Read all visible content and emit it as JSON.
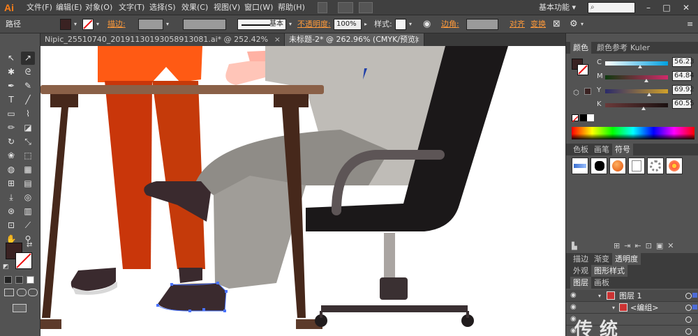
{
  "app": {
    "logo": "Ai"
  },
  "menu": [
    "文件(F)",
    "编辑(E)",
    "对象(O)",
    "文字(T)",
    "选择(S)",
    "效果(C)",
    "视图(V)",
    "窗口(W)",
    "帮助(H)"
  ],
  "workspace": {
    "label": "基本功能",
    "arrow": "▾"
  },
  "search": {
    "icon": "search-icon",
    "glyph": "⌕"
  },
  "window_controls": {
    "minimize": "–",
    "maximize": "□",
    "close": "✕"
  },
  "control_bar": {
    "object_type": "路径",
    "stroke_label": "描边:",
    "stroke_style": "基本",
    "opacity_label": "不透明度:",
    "opacity_value": "100%",
    "style_label": "样式:",
    "corner_label": "边角:",
    "align_label": "对齐",
    "transform_label": "变换",
    "fill_color": "#3a2222"
  },
  "tabs": [
    {
      "label": "Nipic_25510740_20191130193058913081.ai* @ 252.42% (CMYK/预览)",
      "close": "×"
    },
    {
      "label": "未标题-2* @ 262.96% (CMYK/预览)",
      "close": "×"
    }
  ],
  "tools": [
    {
      "icon": "selection-tool-icon",
      "glyph": "↖"
    },
    {
      "icon": "direct-selection-tool-icon",
      "glyph": "↗"
    },
    {
      "icon": "magic-wand-tool-icon",
      "glyph": "✱"
    },
    {
      "icon": "lasso-tool-icon",
      "glyph": "ᘓ"
    },
    {
      "icon": "pen-tool-icon",
      "glyph": "✒"
    },
    {
      "icon": "curvature-tool-icon",
      "glyph": "✎"
    },
    {
      "icon": "type-tool-icon",
      "glyph": "T"
    },
    {
      "icon": "line-tool-icon",
      "glyph": "╱"
    },
    {
      "icon": "rectangle-tool-icon",
      "glyph": "▭"
    },
    {
      "icon": "paintbrush-tool-icon",
      "glyph": "⌇"
    },
    {
      "icon": "pencil-tool-icon",
      "glyph": "✏"
    },
    {
      "icon": "eraser-tool-icon",
      "glyph": "◪"
    },
    {
      "icon": "rotate-tool-icon",
      "glyph": "↻"
    },
    {
      "icon": "scale-tool-icon",
      "glyph": "⤡"
    },
    {
      "icon": "warp-tool-icon",
      "glyph": "❀"
    },
    {
      "icon": "free-transform-tool-icon",
      "glyph": "⬚"
    },
    {
      "icon": "shape-builder-tool-icon",
      "glyph": "◍"
    },
    {
      "icon": "perspective-grid-tool-icon",
      "glyph": "▦"
    },
    {
      "icon": "mesh-tool-icon",
      "glyph": "⊞"
    },
    {
      "icon": "gradient-tool-icon",
      "glyph": "▤"
    },
    {
      "icon": "eyedropper-tool-icon",
      "glyph": "⤓"
    },
    {
      "icon": "blend-tool-icon",
      "glyph": "◎"
    },
    {
      "icon": "symbol-sprayer-tool-icon",
      "glyph": "⊛"
    },
    {
      "icon": "column-graph-tool-icon",
      "glyph": "▥"
    },
    {
      "icon": "artboard-tool-icon",
      "glyph": "⊡"
    },
    {
      "icon": "slice-tool-icon",
      "glyph": "⟋"
    },
    {
      "icon": "hand-tool-icon",
      "glyph": "✋"
    },
    {
      "icon": "zoom-tool-icon",
      "glyph": "⚲"
    }
  ],
  "color_panel": {
    "tabs": [
      "颜色",
      "颜色参考",
      "Kuler"
    ],
    "fill": "#3a2222",
    "channels": [
      {
        "label": "C",
        "value": "56.23",
        "pos": 0.56,
        "gradient": [
          "#ffffff",
          "#00a0e0"
        ]
      },
      {
        "label": "M",
        "value": "64.84",
        "pos": 0.65,
        "gradient": [
          "#0f3a0f",
          "#d12a6a"
        ]
      },
      {
        "label": "Y",
        "value": "69.92",
        "pos": 0.7,
        "gradient": [
          "#2a2a6a",
          "#d0a02a"
        ]
      },
      {
        "label": "K",
        "value": "60.55",
        "pos": 0.61,
        "gradient": [
          "#6a3a3a",
          "#1a1010"
        ]
      }
    ]
  },
  "swatch_panel": {
    "tabs": [
      "色板",
      "画笔",
      "符号"
    ]
  },
  "appearance_panel": {
    "tabs": [
      "描边",
      "渐变",
      "透明度"
    ]
  },
  "graphic_styles_panel": {
    "tabs": [
      "外观",
      "图形样式"
    ]
  },
  "layers_panel": {
    "tabs": [
      "图层",
      "画板"
    ],
    "layers": [
      {
        "name": "图层 1"
      },
      {
        "name": "<编组>"
      }
    ]
  },
  "watermark": "传统"
}
